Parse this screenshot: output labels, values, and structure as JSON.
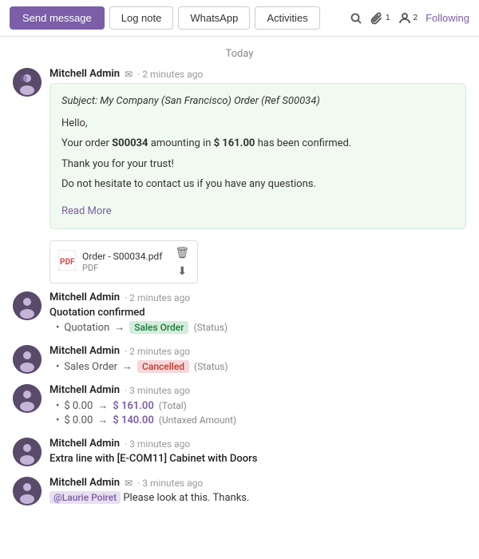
{
  "toolbar": {
    "send_message_label": "Send message",
    "log_note_label": "Log note",
    "whatsapp_label": "WhatsApp",
    "activities_label": "Activities",
    "following_label": "Following",
    "clip_badge": "1",
    "person_badge": "2"
  },
  "chatter": {
    "date_separator": "Today",
    "messages": [
      {
        "id": "email-msg-1",
        "author": "Mitchell Admin",
        "time": "2 minutes ago",
        "has_email": true,
        "subject": "Subject: My Company (San Francisco) Order (Ref S00034)",
        "greeting": "Hello,",
        "body_line1_pre": "Your order ",
        "body_order_ref": "S00034",
        "body_line1_post": " amounting in ",
        "body_amount": "$ 161.00",
        "body_line1_end": " has been confirmed.",
        "body_line2": "Thank you for your trust!",
        "body_line3": "Do not hesitate to contact us if you have any questions.",
        "read_more": "Read More"
      }
    ],
    "attachment": {
      "name": "Order - S00034.pdf",
      "type": "PDF"
    },
    "log_entries": [
      {
        "id": "log-1",
        "author": "Mitchell Admin",
        "time": "2 minutes ago",
        "title": "Quotation confirmed",
        "changes": [
          {
            "label": "Quotation",
            "arrow": "→",
            "value": "Sales Order",
            "value_type": "sales-order",
            "status_label": "(Status)"
          }
        ]
      },
      {
        "id": "log-2",
        "author": "Mitchell Admin",
        "time": "2 minutes ago",
        "title": "",
        "changes": [
          {
            "label": "Sales Order",
            "arrow": "→",
            "value": "Cancelled",
            "value_type": "cancelled",
            "status_label": "(Status)"
          }
        ]
      },
      {
        "id": "log-3",
        "author": "Mitchell Admin",
        "time": "3 minutes ago",
        "title": "",
        "changes": [
          {
            "label": "$ 0.00",
            "arrow": "→",
            "value": "$ 161.00",
            "value_type": "amount",
            "status_label": "(Total)"
          },
          {
            "label": "$ 0.00",
            "arrow": "→",
            "value": "$ 140.00",
            "value_type": "amount",
            "status_label": "(Untaxed Amount)"
          }
        ]
      },
      {
        "id": "log-4",
        "author": "Mitchell Admin",
        "time": "3 minutes ago",
        "title": "Extra line with [E-COM11] Cabinet with Doors",
        "changes": []
      },
      {
        "id": "log-5",
        "author": "Mitchell Admin",
        "time": "3 minutes ago",
        "title": "",
        "has_email": true,
        "mention": "@Laurie Poiret",
        "mention_text": " Please look at this. Thanks.",
        "changes": []
      }
    ]
  }
}
